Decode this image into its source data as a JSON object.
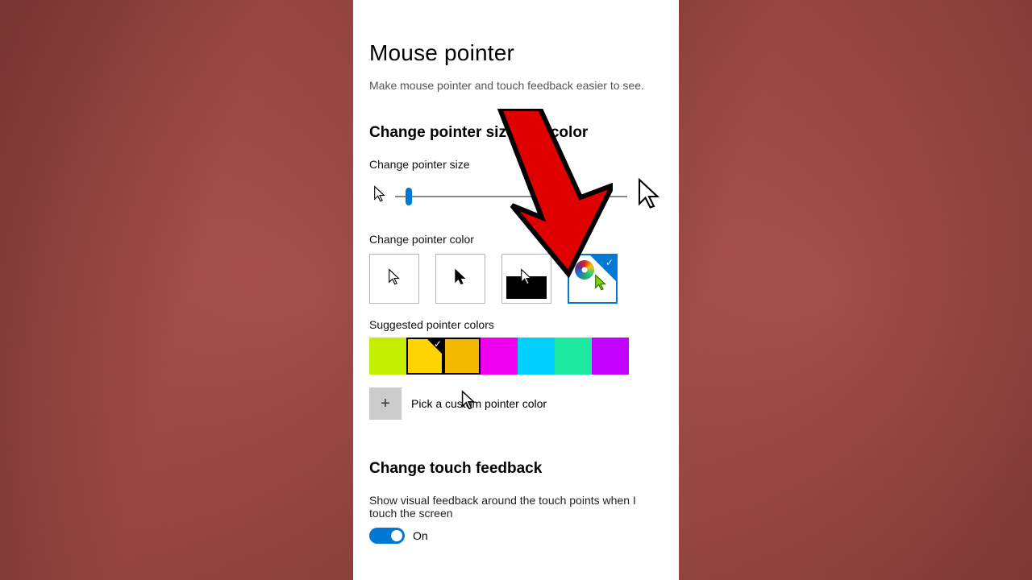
{
  "page": {
    "title": "Mouse pointer",
    "subhead": "Make mouse pointer and touch feedback easier to see."
  },
  "section1": {
    "heading": "Change pointer size and color",
    "size_label": "Change pointer size",
    "color_label": "Change pointer color",
    "suggested_label": "Suggested pointer colors",
    "custom_label": "Pick a custom pointer color"
  },
  "slider": {
    "value_percent": 6
  },
  "schemes": [
    {
      "id": "white",
      "selected": false
    },
    {
      "id": "black",
      "selected": false
    },
    {
      "id": "inverted",
      "selected": false
    },
    {
      "id": "custom",
      "selected": true
    }
  ],
  "swatches": [
    {
      "color": "#c4f000",
      "selected": false
    },
    {
      "color": "#ffd400",
      "selected": true
    },
    {
      "color": "#f2b800",
      "selected": false,
      "hover": true
    },
    {
      "color": "#ee00ee",
      "selected": false
    },
    {
      "color": "#00d0ff",
      "selected": false
    },
    {
      "color": "#1de9a1",
      "selected": false
    },
    {
      "color": "#c400ff",
      "selected": false
    }
  ],
  "section2": {
    "heading": "Change touch feedback",
    "description": "Show visual feedback around the touch points when I touch the screen",
    "toggle_on": true,
    "toggle_label": "On"
  },
  "icons": {
    "plus": "+",
    "check": "✓"
  }
}
